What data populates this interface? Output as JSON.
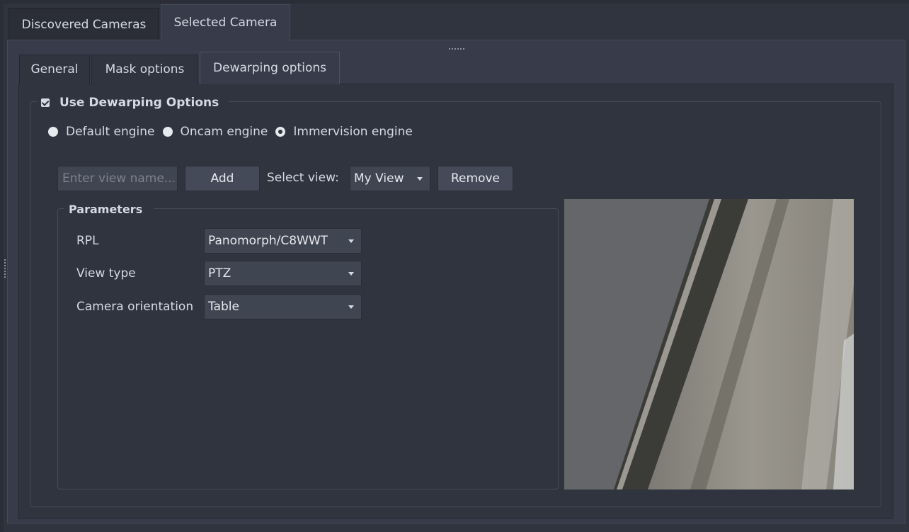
{
  "outer_tabs": [
    {
      "label": "Discovered Cameras",
      "active": false
    },
    {
      "label": "Selected Camera",
      "active": true
    }
  ],
  "inner_tabs": [
    {
      "label": "General",
      "active": false
    },
    {
      "label": "Mask options",
      "active": false
    },
    {
      "label": "Dewarping options",
      "active": true
    }
  ],
  "dewarping": {
    "use_label": "Use Dewarping Options",
    "use_checked": true,
    "engines": [
      {
        "label": "Default engine",
        "checked": false
      },
      {
        "label": "Oncam engine",
        "checked": false
      },
      {
        "label": "Immervision engine",
        "checked": true
      }
    ]
  },
  "views": {
    "name_placeholder": "Enter view name...",
    "add_label": "Add",
    "select_label": "Select view:",
    "selected_view": "My View",
    "remove_label": "Remove"
  },
  "parameters": {
    "title": "Parameters",
    "rpl_label": "RPL",
    "rpl_value": "Panomorph/C8WWT",
    "view_type_label": "View type",
    "view_type_value": "PTZ",
    "orientation_label": "Camera orientation",
    "orientation_value": "Table"
  },
  "colors": {
    "background": "#2f343f",
    "panel": "#383c4a",
    "text": "#d3dae3"
  }
}
